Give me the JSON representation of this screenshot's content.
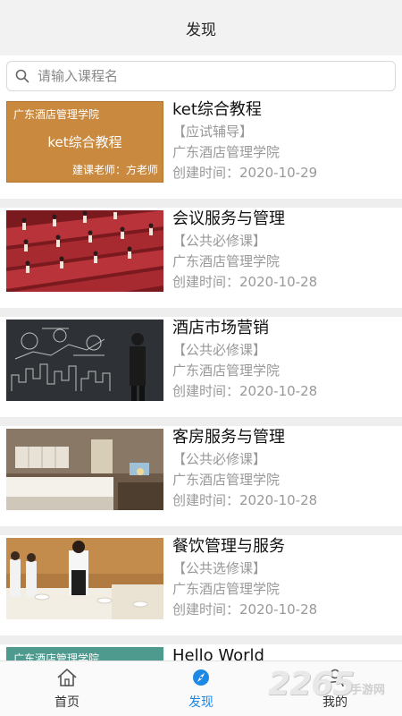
{
  "header": {
    "title": "发现"
  },
  "search": {
    "placeholder": "请输入课程名"
  },
  "courses": [
    {
      "title": "ket综合教程",
      "category": "【应试辅导】",
      "school": "广东酒店管理学院",
      "created": "创建时间：2020-10-29",
      "cover": {
        "school": "广东酒店管理学院",
        "title": "ket综合教程",
        "teacher": "建课老师：方老师",
        "color": "#c8873e"
      }
    },
    {
      "title": "会议服务与管理",
      "category": "【公共必修课】",
      "school": "广东酒店管理学院",
      "created": "创建时间：2020-10-28"
    },
    {
      "title": "酒店市场营销",
      "category": "【公共必修课】",
      "school": "广东酒店管理学院",
      "created": "创建时间：2020-10-28"
    },
    {
      "title": "客房服务与管理",
      "category": "【公共必修课】",
      "school": "广东酒店管理学院",
      "created": "创建时间：2020-10-28"
    },
    {
      "title": "餐饮管理与服务",
      "category": "【公共选修课】",
      "school": "广东酒店管理学院",
      "created": "创建时间：2020-10-28"
    },
    {
      "title": "Hello World",
      "cover": {
        "school": "广东酒店管理学院",
        "color": "#4f9a8e"
      }
    }
  ],
  "tabs": [
    {
      "label": "首页",
      "icon": "home-icon"
    },
    {
      "label": "发现",
      "icon": "discover-icon",
      "active": true
    },
    {
      "label": "我的",
      "icon": "user-icon"
    }
  ],
  "watermark": {
    "number": "2265",
    "text": "手游网"
  },
  "colors": {
    "accent": "#1e88e5",
    "header_bg": "#f2f2f2",
    "muted_text": "#999999"
  }
}
